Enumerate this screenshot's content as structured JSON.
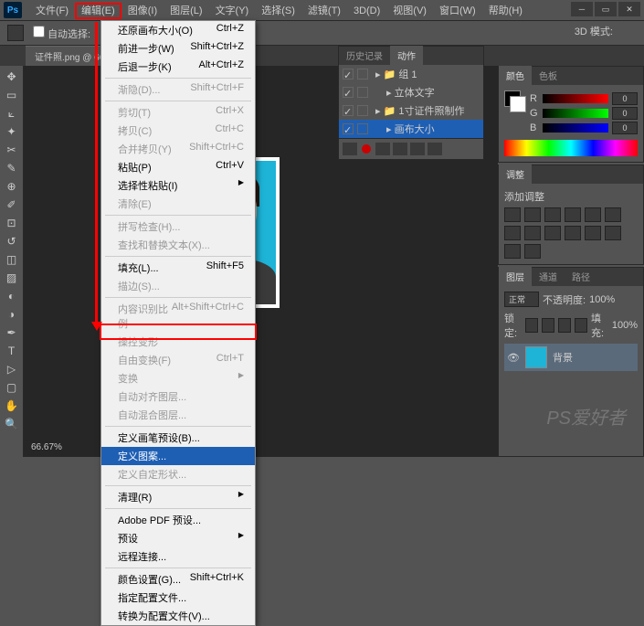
{
  "menubar": {
    "items": [
      "文件(F)",
      "编辑(E)",
      "图像(I)",
      "图层(L)",
      "文字(Y)",
      "选择(S)",
      "滤镜(T)",
      "3D(D)",
      "视图(V)",
      "窗口(W)",
      "帮助(H)"
    ],
    "highlighted_index": 1
  },
  "optbar": {
    "auto_select": "自动选择:",
    "right_3d": "3D 模式:"
  },
  "document": {
    "tab": "证件照.png @ 66...",
    "zoom": "66.67%"
  },
  "dropdown": {
    "items": [
      {
        "label": "还原画布大小(O)",
        "shortcut": "Ctrl+Z"
      },
      {
        "label": "前进一步(W)",
        "shortcut": "Shift+Ctrl+Z"
      },
      {
        "label": "后退一步(K)",
        "shortcut": "Alt+Ctrl+Z"
      },
      {
        "sep": true
      },
      {
        "label": "渐隐(D)...",
        "shortcut": "Shift+Ctrl+F",
        "disabled": true
      },
      {
        "sep": true
      },
      {
        "label": "剪切(T)",
        "shortcut": "Ctrl+X",
        "disabled": true
      },
      {
        "label": "拷贝(C)",
        "shortcut": "Ctrl+C",
        "disabled": true
      },
      {
        "label": "合并拷贝(Y)",
        "shortcut": "Shift+Ctrl+C",
        "disabled": true
      },
      {
        "label": "粘贴(P)",
        "shortcut": "Ctrl+V"
      },
      {
        "label": "选择性粘贴(I)",
        "submenu": true
      },
      {
        "label": "清除(E)",
        "disabled": true
      },
      {
        "sep": true
      },
      {
        "label": "拼写检查(H)...",
        "disabled": true
      },
      {
        "label": "查找和替换文本(X)...",
        "disabled": true
      },
      {
        "sep": true
      },
      {
        "label": "填充(L)...",
        "shortcut": "Shift+F5"
      },
      {
        "label": "描边(S)...",
        "disabled": true
      },
      {
        "sep": true
      },
      {
        "label": "内容识别比例",
        "shortcut": "Alt+Shift+Ctrl+C",
        "disabled": true
      },
      {
        "label": "操控变形",
        "disabled": true
      },
      {
        "label": "自由变换(F)",
        "shortcut": "Ctrl+T",
        "disabled": true
      },
      {
        "label": "变换",
        "submenu": true,
        "disabled": true
      },
      {
        "label": "自动对齐图层...",
        "disabled": true
      },
      {
        "label": "自动混合图层...",
        "disabled": true
      },
      {
        "sep": true
      },
      {
        "label": "定义画笔预设(B)..."
      },
      {
        "label": "定义图案...",
        "selected": true
      },
      {
        "label": "定义自定形状...",
        "disabled": true
      },
      {
        "sep": true
      },
      {
        "label": "清理(R)",
        "submenu": true
      },
      {
        "sep": true
      },
      {
        "label": "Adobe PDF 预设..."
      },
      {
        "label": "预设",
        "submenu": true
      },
      {
        "label": "远程连接..."
      },
      {
        "sep": true
      },
      {
        "label": "颜色设置(G)...",
        "shortcut": "Shift+Ctrl+K"
      },
      {
        "label": "指定配置文件..."
      },
      {
        "label": "转换为配置文件(V)..."
      }
    ]
  },
  "history_panel": {
    "tabs": [
      "历史记录",
      "动作"
    ],
    "items": [
      {
        "label": "组 1",
        "folder": true
      },
      {
        "label": "立体文字"
      },
      {
        "label": "1寸证件照制作",
        "folder": true
      },
      {
        "label": "画布大小",
        "selected": true
      }
    ]
  },
  "color_panel": {
    "tabs": [
      "颜色",
      "色板"
    ],
    "r": "0",
    "g": "0",
    "b": "0"
  },
  "adjust_panel": {
    "tab": "调整",
    "title": "添加调整"
  },
  "layers_panel": {
    "tabs": [
      "图层",
      "通道",
      "路径"
    ],
    "kind": "正常",
    "opacity_label": "不透明度:",
    "opacity": "100%",
    "lock_label": "锁定:",
    "fill_label": "填充:",
    "fill": "100%",
    "layer_name": "背景"
  },
  "watermark": "PS爱好者"
}
